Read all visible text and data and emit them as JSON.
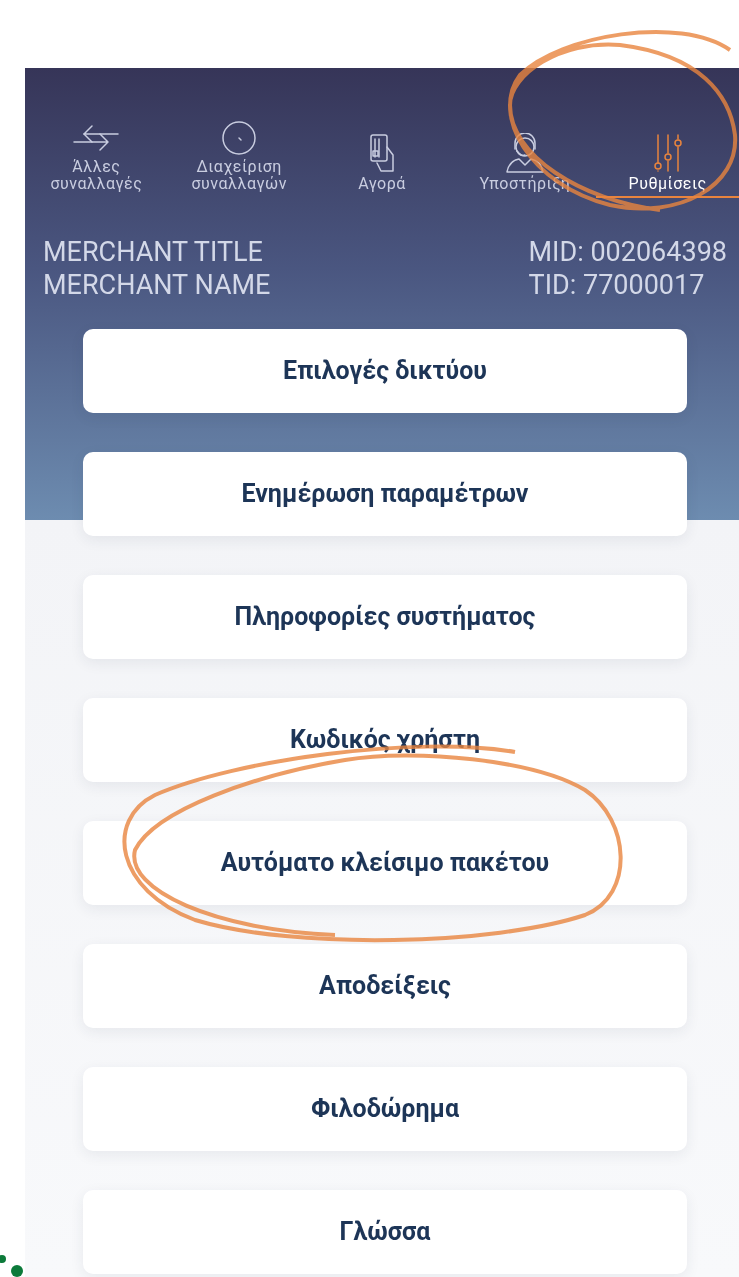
{
  "tabs": [
    {
      "label": "Άλλες\nσυναλλαγές",
      "kind": "arrows",
      "selected": false
    },
    {
      "label": "Διαχείριση\nσυναλλαγών",
      "kind": "clock",
      "selected": false
    },
    {
      "label": "Αγορά",
      "kind": "card",
      "selected": false
    },
    {
      "label": "Υποστήριξη",
      "kind": "headset",
      "selected": false
    },
    {
      "label": "Ρυθμίσεις",
      "kind": "sliders",
      "selected": true
    }
  ],
  "merchant": {
    "title": "MERCHANT TITLE",
    "name": "MERCHANT NAME",
    "mid": "MID: 002064398",
    "tid": "TID: 77000017"
  },
  "menu": [
    "Επιλογές δικτύου",
    "Ενημέρωση παραμέτρων",
    "Πληροφορίες συστήματος",
    "Κωδικός χρήστη",
    "Αυτόματο κλείσιμο πακέτου",
    "Αποδείξεις",
    "Φιλοδώρημα",
    "Γλώσσα"
  ]
}
